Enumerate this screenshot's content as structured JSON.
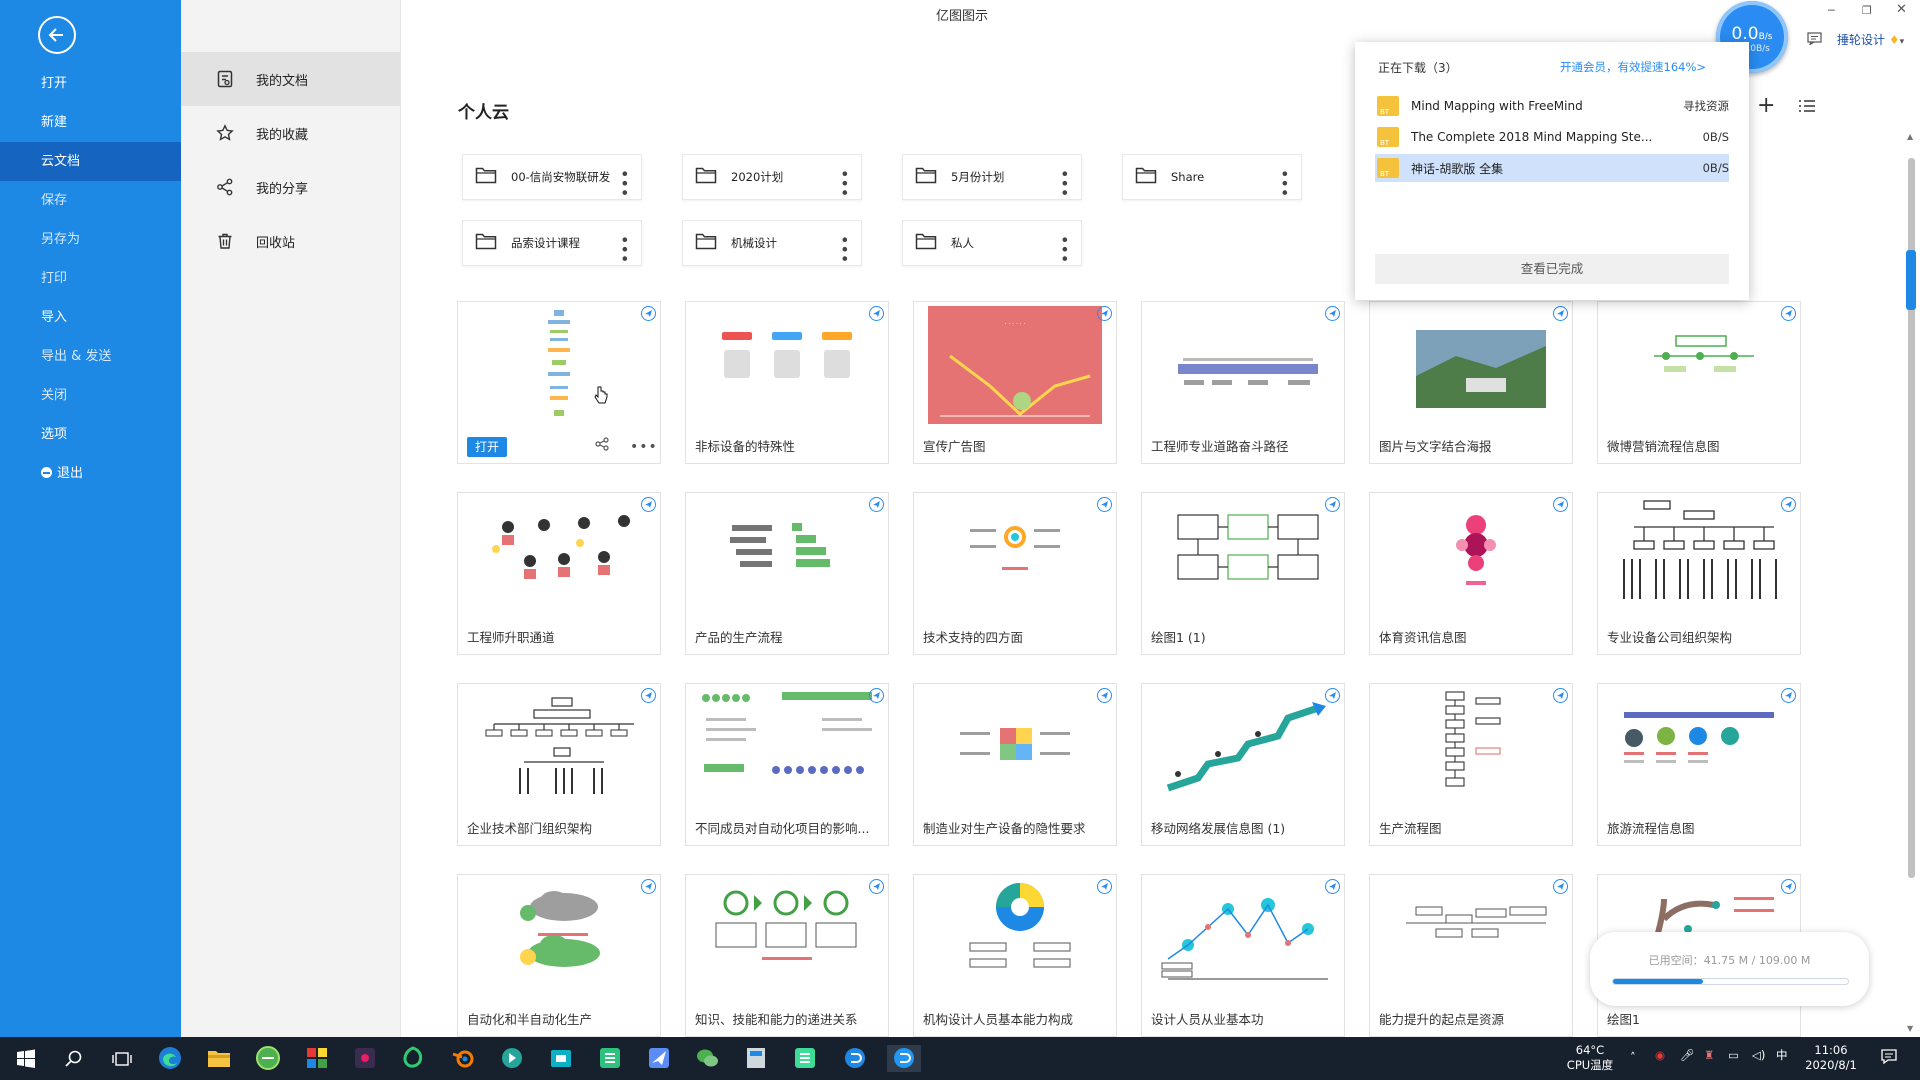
{
  "window": {
    "title": "亿图图示"
  },
  "left_nav": {
    "items": [
      {
        "label": "打开"
      },
      {
        "label": "新建"
      },
      {
        "label": "云文档"
      },
      {
        "label": "保存"
      },
      {
        "label": "另存为"
      },
      {
        "label": "打印"
      },
      {
        "label": "导入"
      },
      {
        "label": "导出 & 发送"
      },
      {
        "label": "关闭"
      },
      {
        "label": "选项"
      },
      {
        "label": "退出"
      }
    ],
    "active_index": 2
  },
  "doc_panel": {
    "items": [
      {
        "label": "我的文档",
        "icon": "my-docs-icon"
      },
      {
        "label": "我的收藏",
        "icon": "star-icon"
      },
      {
        "label": "我的分享",
        "icon": "share-icon"
      },
      {
        "label": "回收站",
        "icon": "trash-icon"
      }
    ]
  },
  "main": {
    "section_title": "个人云",
    "folders": [
      {
        "name": "00-信尚安物联研发"
      },
      {
        "name": "2020计划"
      },
      {
        "name": "5月份计划"
      },
      {
        "name": "Share"
      },
      {
        "name": "品索设计课程"
      },
      {
        "name": "机械设计"
      },
      {
        "name": "私人"
      }
    ],
    "cards": [
      {
        "name": ""
      },
      {
        "name": "非标设备的特殊性"
      },
      {
        "name": "宣传广告图"
      },
      {
        "name": "工程师专业道路奋斗路径"
      },
      {
        "name": "图片与文字结合海报"
      },
      {
        "name": "微博营销流程信息图"
      },
      {
        "name": "工程师升职通道"
      },
      {
        "name": "产品的生产流程"
      },
      {
        "name": "技术支持的四方面"
      },
      {
        "name": "绘图1 (1)"
      },
      {
        "name": "体育资讯信息图"
      },
      {
        "name": "专业设备公司组织架构"
      },
      {
        "name": "企业技术部门组织架构"
      },
      {
        "name": "不同成员对自动化项目的影响..."
      },
      {
        "name": "制造业对生产设备的隐性要求"
      },
      {
        "name": "移动网络发展信息图 (1)"
      },
      {
        "name": "生产流程图"
      },
      {
        "name": "旅游流程信息图"
      },
      {
        "name": "自动化和半自动化生产"
      },
      {
        "name": "知识、技能和能力的递进关系"
      },
      {
        "name": "机构设计人员基本能力构成"
      },
      {
        "name": "设计人员从业基本功"
      },
      {
        "name": "能力提升的起点是资源"
      },
      {
        "name": "绘图1"
      }
    ],
    "first_card": {
      "open_label": "打开"
    }
  },
  "download_popup": {
    "title": "正在下载（3）",
    "vip_link": "开通会员，有效提速164%>",
    "items": [
      {
        "name": "Mind Mapping with FreeMind",
        "status": "寻找资源"
      },
      {
        "name": "The Complete 2018 Mind Mapping Ste...",
        "status": "0B/S"
      },
      {
        "name": "神话-胡歌版 全集",
        "status": "0B/S"
      }
    ],
    "view_done": "查看已完成"
  },
  "speed_ball": {
    "speed": "0.0",
    "unit": "B/s",
    "sub": "+0.0B/s"
  },
  "user": {
    "name": "捶轮设计"
  },
  "storage": {
    "label": "已用空间：41.75 M / 109.00 M",
    "used_fraction": 0.383
  },
  "taskbar": {
    "temp": "64°C",
    "cpu": "CPU温度",
    "ime": "中",
    "time": "11:06",
    "date": "2020/8/1"
  },
  "colors": {
    "accent": "#1e88e5",
    "sidebar": "#1e88e5",
    "active_nav": "#1565c0",
    "taskbar": "#17212e"
  }
}
